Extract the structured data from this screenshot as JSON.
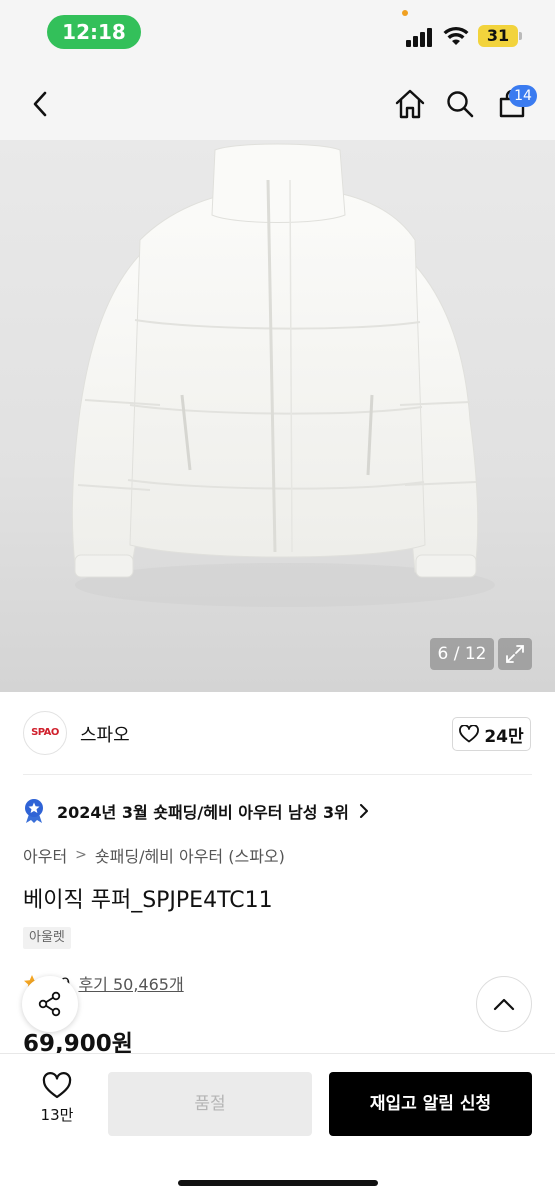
{
  "status_bar": {
    "time": "12:18",
    "battery": "31"
  },
  "header": {
    "cart_count": "14"
  },
  "gallery": {
    "counter": "6 / 12"
  },
  "brand": {
    "logo_text": "SPAO",
    "name": "스파오",
    "likes": "24만"
  },
  "ranking": {
    "text": "2024년 3월 숏패딩/헤비 아우터 남성 3위"
  },
  "breadcrumb": {
    "items": [
      "아우터",
      "숏패딩/헤비 아우터 (스파오)"
    ]
  },
  "product": {
    "title": "베이직 푸퍼_SPJPE4TC11",
    "tag": "아울렛",
    "rating": "4.9",
    "reviews": "후기 50,465개",
    "price": "69,900원"
  },
  "bottom_bar": {
    "wish_count": "13만",
    "soldout_label": "품절",
    "restock_label": "재입고 알림 신청"
  },
  "colors": {
    "accent_blue": "#3a7bf0",
    "status_green": "#33c05a",
    "brand_red": "#d0202c",
    "cta_black": "#000000"
  }
}
